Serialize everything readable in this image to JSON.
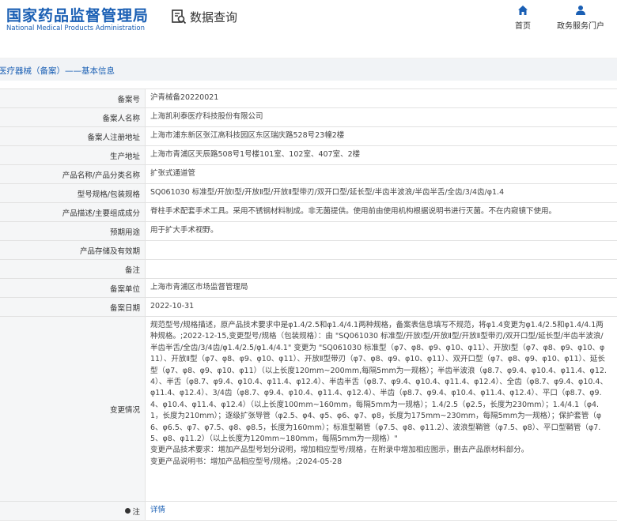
{
  "header": {
    "logo_cn": "国家药品监督管理局",
    "logo_en": "National Medical Products Administration",
    "site_name": "数据查询",
    "nav": [
      {
        "label": "首页",
        "icon": "home-icon"
      },
      {
        "label": "政务服务门户",
        "icon": "user-icon"
      }
    ]
  },
  "breadcrumb": "医疗器械（备案）——基本信息",
  "rows": [
    {
      "key": "备案号",
      "value": "沪青械备20220021"
    },
    {
      "key": "备案人名称",
      "value": "上海凯利泰医疗科技股份有限公司"
    },
    {
      "key": "备案人注册地址",
      "value": "上海市浦东新区张江高科技园区东区瑞庆路528号23幢2楼"
    },
    {
      "key": "生产地址",
      "value": "上海市青浦区天辰路508号1号楼101室、102室、407室、2楼"
    },
    {
      "key": "产品名称/产品分类名称",
      "value": "扩张式通道管"
    },
    {
      "key": "型号规格/包装规格",
      "value": "SQ061030 标准型/开放Ⅰ型/开放Ⅱ型/开放Ⅱ型带刃/双开口型/延长型/半齿半波浪/半齿半舌/全齿/3/4齿/φ1.4"
    },
    {
      "key": "产品描述/主要组成成分",
      "value": "脊柱手术配套手术工具。采用不锈钢材料制成。非无菌提供。使用前由使用机构根据说明书进行灭菌。不在内窥镜下使用。"
    },
    {
      "key": "预期用途",
      "value": "用于扩大手术视野。"
    },
    {
      "key": "产品存储及有效期",
      "value": ""
    },
    {
      "key": "备注",
      "value": ""
    },
    {
      "key": "备案单位",
      "value": "上海市青浦区市场监督管理局"
    },
    {
      "key": "备案日期",
      "value": "2022-10-31"
    }
  ],
  "change": {
    "key": "变更情况",
    "lines": [
      "规范型号/规格描述，原产品技术要求中是φ1.4/2.5和φ1.4/4.1两种规格，备案表信息填写不规范，将φ1.4变更为φ1.4/2.5和φ1.4/4.1两种规格。;2022-12-15,变更型号/规格（包装规格）：由 \"SQ061030 标准型/开放Ⅰ型/开放Ⅱ型/开放Ⅱ型带刃/双开口型/延长型/半齿半波浪/半齿半舌/全齿/3/4齿/φ1.4/2.5/φ1.4/4.1\" 变更为 \"SQ061030 标准型（φ7、φ8、φ9、φ10、φ11）、开放Ⅰ型（φ7、φ8、φ9、φ10、φ11）、开放Ⅱ型（φ7、φ8、φ9、φ10、φ11）、开放Ⅱ型带刃（φ7、φ8、φ9、φ10、φ11）、双开口型（φ7、φ8、φ9、φ10、φ11）、延长型（φ7、φ8、φ9、φ10、φ11）（以上长度120mm~200mm,每隔5mm为一规格）；半齿半波浪（φ8.7、φ9.4、φ10.4、φ11.4、φ12.4）、半舌（φ8.7、φ9.4、φ10.4、φ11.4、φ12.4）、半齿半舌（φ8.7、φ9.4、φ10.4、φ11.4、φ12.4）、全齿（φ8.7、φ9.4、φ10.4、φ11.4、φ12.4）、3/4齿（φ8.7、φ9.4、φ10.4、φ11.4、φ12.4）、半齿（φ8.7、φ9.4、φ10.4、φ11.4、φ12.4）、平口（φ8.7、φ9.4、φ10.4、φ11.4、φ12.4）（以上长度100mm~160mm，每隔5mm为一规格）；1.4/2.5（φ2.5，长度为230mm）；1.4/4.1（φ4.1，长度为210mm）；逐级扩张导管（φ2.5、φ4、φ5、φ6、φ7、φ8，长度为175mm~230mm，每隔5mm为一规格）；保护套管（φ6、φ6.5、φ7、φ7.5、φ8、φ8.5，长度为160mm）；标准型鞘管（φ7.5、φ8、φ11.2）、波浪型鞘管（φ7.5、φ8）、平口型鞘管（φ7.5、φ8、φ11.2）（以上长度为120mm~180mm，每隔5mm为一规格）\"",
      "变更产品技术要求：增加产品型号划分说明，增加相应型号/规格，在附录中增加相应图示，删去产品原材料部分。",
      "变更产品说明书：增加产品相应型号/规格。;2024-05-28"
    ]
  },
  "note": {
    "key": "注",
    "link": "详情"
  },
  "colors": {
    "brand": "#1a5fb4",
    "label_bg": "#f5f6f7",
    "crumb_bg": "#f1f3f6"
  }
}
